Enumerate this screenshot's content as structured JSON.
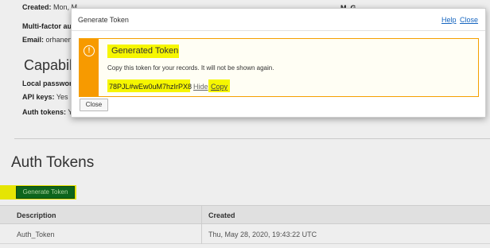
{
  "background": {
    "created_label": "Created:",
    "created_value": "Mon, M",
    "mfa_label": "Multi-factor auth",
    "email_label": "Email:",
    "email_value": "orhanenp",
    "right_fragment": "M. G",
    "capabilities_title": "Capabilitie",
    "local_password_label": "Local password",
    "api_keys_label": "API keys:",
    "api_keys_value": "Yes",
    "auth_tokens_label": "Auth tokens:",
    "auth_tokens_value": "Ye",
    "section_title": "Auth Tokens",
    "generate_button_label": "Generate Token",
    "table": {
      "headers": [
        "Description",
        "Created"
      ],
      "rows": [
        [
          "Auth_Token",
          "Thu, May 28, 2020, 19:43:22 UTC"
        ]
      ]
    }
  },
  "modal": {
    "title": "Generate Token",
    "help_label": "Help",
    "close_link_label": "Close",
    "alert": {
      "icon": "exclamation-icon",
      "title": "Generated Token",
      "message": "Copy this token for your records. It will not be shown again.",
      "token": "78PJL#wEw0uM7hzIrPX8",
      "hide_label": "Hide",
      "copy_label": "Copy"
    },
    "close_button_label": "Close"
  },
  "colors": {
    "alert_accent": "#f79a00",
    "highlight": "#f6f600",
    "link": "#1565c0",
    "primary_button": "#0b6b1c"
  }
}
